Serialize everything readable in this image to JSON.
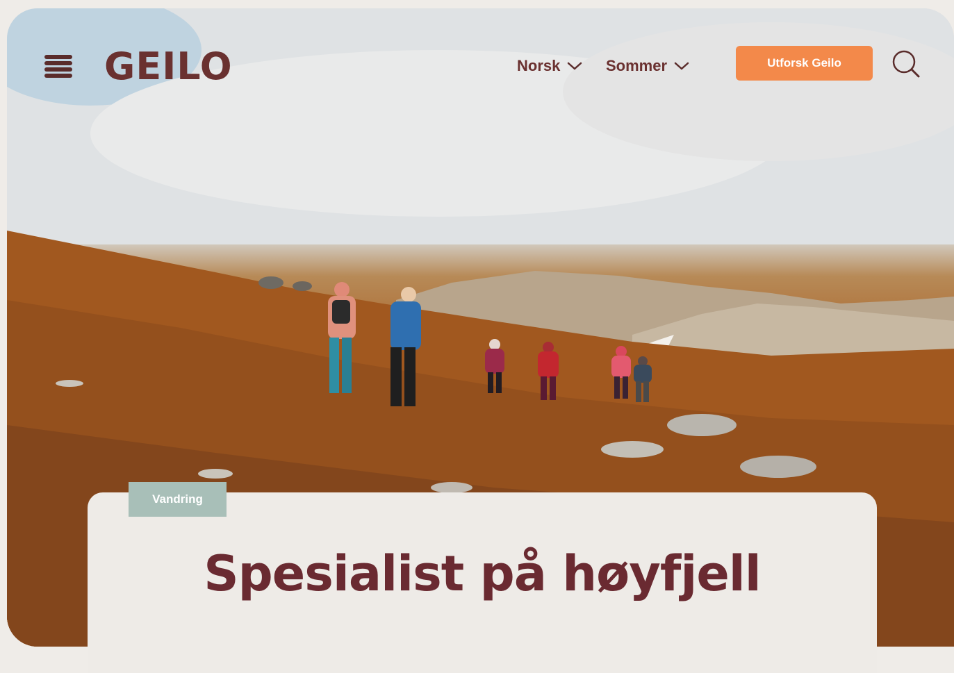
{
  "brand": {
    "logo_text": "GEILO"
  },
  "nav": {
    "language_label": "Norsk",
    "season_label": "Sommer"
  },
  "cta": {
    "label": "Utforsk Geilo"
  },
  "hero": {
    "category_tag": "Vandring",
    "title": "Spesialist på høyfjell",
    "image_alt_icon": "hikers-landscape"
  },
  "icons": {
    "menu": "hamburger-icon",
    "language": "chevron-down-icon",
    "season": "chevron-down-icon",
    "search": "search-icon"
  },
  "colors": {
    "brand_text": "#6a3130",
    "cta_background": "#f3894a",
    "tag_background": "#a8bfb8",
    "card_background": "#eeebe7",
    "title_text": "#6a2a31"
  }
}
